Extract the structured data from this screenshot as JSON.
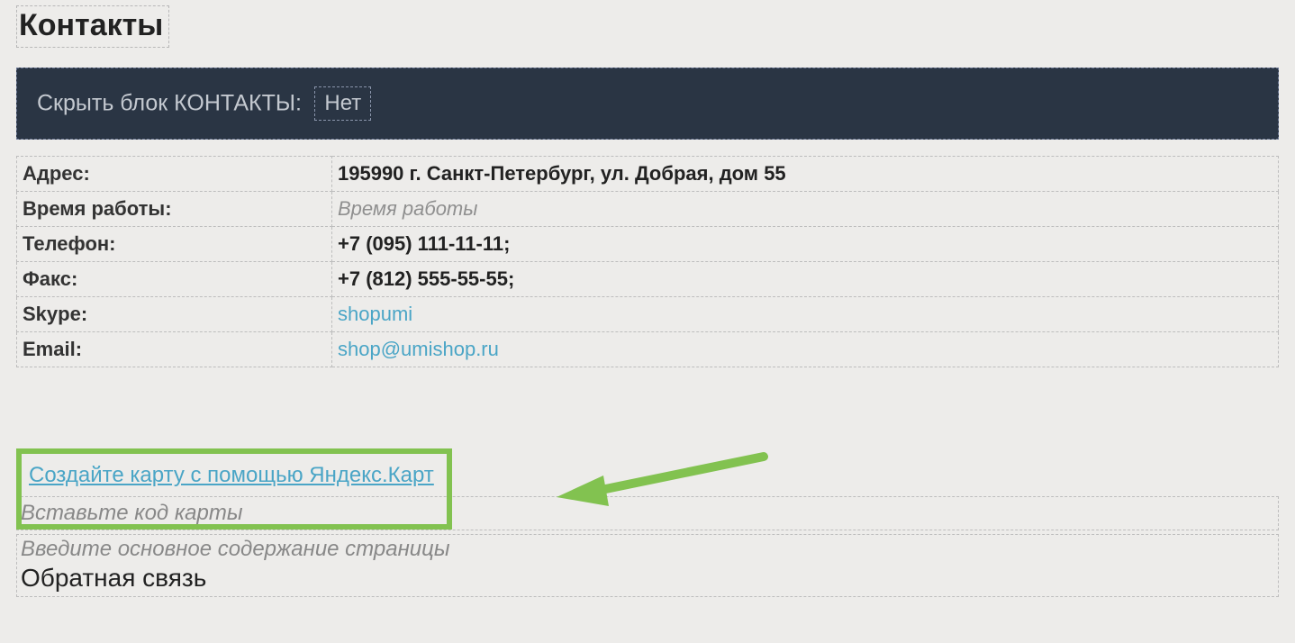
{
  "title": "Контакты",
  "hide_block": {
    "label": "Скрыть блок КОНТАКТЫ:",
    "value": "Нет"
  },
  "fields": {
    "address": {
      "label": "Адрес:",
      "value": "195990 г. Санкт-Петербург, ул. Добрая, дом 55"
    },
    "hours": {
      "label": "Время работы:",
      "placeholder": "Время работы"
    },
    "phone": {
      "label": "Телефон:",
      "value": "+7 (095) 111-11-11;"
    },
    "fax": {
      "label": "Факс:",
      "value": "+7 (812) 555-55-55;"
    },
    "skype": {
      "label": "Skype:",
      "value": "shopumi"
    },
    "email": {
      "label": "Email:",
      "value": "shop@umishop.ru"
    }
  },
  "map_link": "Создайте карту с помощью Яндекс.Карт",
  "map_code_placeholder": "Вставьте код карты",
  "content_placeholder": "Введите основное содержание страницы",
  "feedback_heading": "Обратная связь"
}
